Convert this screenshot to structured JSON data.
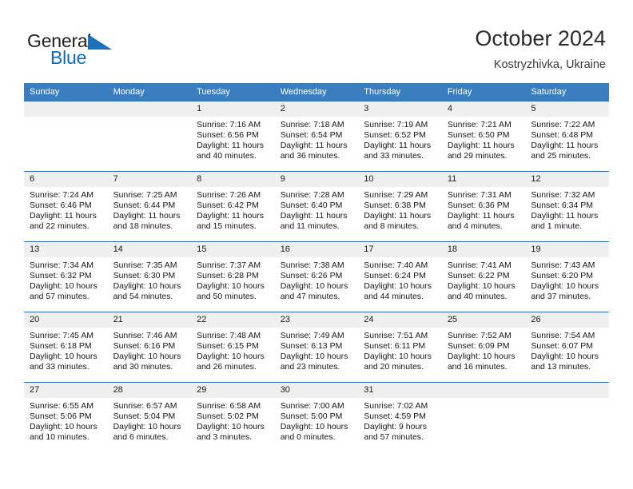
{
  "brand": {
    "name_part1": "General",
    "name_part2": "Blue",
    "flag_icon": "triangle-flag-icon"
  },
  "header": {
    "title": "October 2024",
    "location": "Kostryzhivka, Ukraine"
  },
  "colors": {
    "header_blue": "#3b7ebf",
    "row_rule_blue": "#2b6ca8",
    "daynum_gray": "#efefef",
    "brand_blue": "#0a6bc4"
  },
  "calendar": {
    "weekday_headers": [
      "Sunday",
      "Monday",
      "Tuesday",
      "Wednesday",
      "Thursday",
      "Friday",
      "Saturday"
    ],
    "weeks": [
      [
        {
          "day": "",
          "sunrise": "",
          "sunset": "",
          "daylight1": "",
          "daylight2": "",
          "empty": true
        },
        {
          "day": "",
          "sunrise": "",
          "sunset": "",
          "daylight1": "",
          "daylight2": "",
          "empty": true
        },
        {
          "day": "1",
          "sunrise": "Sunrise: 7:16 AM",
          "sunset": "Sunset: 6:56 PM",
          "daylight1": "Daylight: 11 hours",
          "daylight2": "and 40 minutes.",
          "empty": false
        },
        {
          "day": "2",
          "sunrise": "Sunrise: 7:18 AM",
          "sunset": "Sunset: 6:54 PM",
          "daylight1": "Daylight: 11 hours",
          "daylight2": "and 36 minutes.",
          "empty": false
        },
        {
          "day": "3",
          "sunrise": "Sunrise: 7:19 AM",
          "sunset": "Sunset: 6:52 PM",
          "daylight1": "Daylight: 11 hours",
          "daylight2": "and 33 minutes.",
          "empty": false
        },
        {
          "day": "4",
          "sunrise": "Sunrise: 7:21 AM",
          "sunset": "Sunset: 6:50 PM",
          "daylight1": "Daylight: 11 hours",
          "daylight2": "and 29 minutes.",
          "empty": false
        },
        {
          "day": "5",
          "sunrise": "Sunrise: 7:22 AM",
          "sunset": "Sunset: 6:48 PM",
          "daylight1": "Daylight: 11 hours",
          "daylight2": "and 25 minutes.",
          "empty": false
        }
      ],
      [
        {
          "day": "6",
          "sunrise": "Sunrise: 7:24 AM",
          "sunset": "Sunset: 6:46 PM",
          "daylight1": "Daylight: 11 hours",
          "daylight2": "and 22 minutes.",
          "empty": false
        },
        {
          "day": "7",
          "sunrise": "Sunrise: 7:25 AM",
          "sunset": "Sunset: 6:44 PM",
          "daylight1": "Daylight: 11 hours",
          "daylight2": "and 18 minutes.",
          "empty": false
        },
        {
          "day": "8",
          "sunrise": "Sunrise: 7:26 AM",
          "sunset": "Sunset: 6:42 PM",
          "daylight1": "Daylight: 11 hours",
          "daylight2": "and 15 minutes.",
          "empty": false
        },
        {
          "day": "9",
          "sunrise": "Sunrise: 7:28 AM",
          "sunset": "Sunset: 6:40 PM",
          "daylight1": "Daylight: 11 hours",
          "daylight2": "and 11 minutes.",
          "empty": false
        },
        {
          "day": "10",
          "sunrise": "Sunrise: 7:29 AM",
          "sunset": "Sunset: 6:38 PM",
          "daylight1": "Daylight: 11 hours",
          "daylight2": "and 8 minutes.",
          "empty": false
        },
        {
          "day": "11",
          "sunrise": "Sunrise: 7:31 AM",
          "sunset": "Sunset: 6:36 PM",
          "daylight1": "Daylight: 11 hours",
          "daylight2": "and 4 minutes.",
          "empty": false
        },
        {
          "day": "12",
          "sunrise": "Sunrise: 7:32 AM",
          "sunset": "Sunset: 6:34 PM",
          "daylight1": "Daylight: 11 hours",
          "daylight2": "and 1 minute.",
          "empty": false
        }
      ],
      [
        {
          "day": "13",
          "sunrise": "Sunrise: 7:34 AM",
          "sunset": "Sunset: 6:32 PM",
          "daylight1": "Daylight: 10 hours",
          "daylight2": "and 57 minutes.",
          "empty": false
        },
        {
          "day": "14",
          "sunrise": "Sunrise: 7:35 AM",
          "sunset": "Sunset: 6:30 PM",
          "daylight1": "Daylight: 10 hours",
          "daylight2": "and 54 minutes.",
          "empty": false
        },
        {
          "day": "15",
          "sunrise": "Sunrise: 7:37 AM",
          "sunset": "Sunset: 6:28 PM",
          "daylight1": "Daylight: 10 hours",
          "daylight2": "and 50 minutes.",
          "empty": false
        },
        {
          "day": "16",
          "sunrise": "Sunrise: 7:38 AM",
          "sunset": "Sunset: 6:26 PM",
          "daylight1": "Daylight: 10 hours",
          "daylight2": "and 47 minutes.",
          "empty": false
        },
        {
          "day": "17",
          "sunrise": "Sunrise: 7:40 AM",
          "sunset": "Sunset: 6:24 PM",
          "daylight1": "Daylight: 10 hours",
          "daylight2": "and 44 minutes.",
          "empty": false
        },
        {
          "day": "18",
          "sunrise": "Sunrise: 7:41 AM",
          "sunset": "Sunset: 6:22 PM",
          "daylight1": "Daylight: 10 hours",
          "daylight2": "and 40 minutes.",
          "empty": false
        },
        {
          "day": "19",
          "sunrise": "Sunrise: 7:43 AM",
          "sunset": "Sunset: 6:20 PM",
          "daylight1": "Daylight: 10 hours",
          "daylight2": "and 37 minutes.",
          "empty": false
        }
      ],
      [
        {
          "day": "20",
          "sunrise": "Sunrise: 7:45 AM",
          "sunset": "Sunset: 6:18 PM",
          "daylight1": "Daylight: 10 hours",
          "daylight2": "and 33 minutes.",
          "empty": false
        },
        {
          "day": "21",
          "sunrise": "Sunrise: 7:46 AM",
          "sunset": "Sunset: 6:16 PM",
          "daylight1": "Daylight: 10 hours",
          "daylight2": "and 30 minutes.",
          "empty": false
        },
        {
          "day": "22",
          "sunrise": "Sunrise: 7:48 AM",
          "sunset": "Sunset: 6:15 PM",
          "daylight1": "Daylight: 10 hours",
          "daylight2": "and 26 minutes.",
          "empty": false
        },
        {
          "day": "23",
          "sunrise": "Sunrise: 7:49 AM",
          "sunset": "Sunset: 6:13 PM",
          "daylight1": "Daylight: 10 hours",
          "daylight2": "and 23 minutes.",
          "empty": false
        },
        {
          "day": "24",
          "sunrise": "Sunrise: 7:51 AM",
          "sunset": "Sunset: 6:11 PM",
          "daylight1": "Daylight: 10 hours",
          "daylight2": "and 20 minutes.",
          "empty": false
        },
        {
          "day": "25",
          "sunrise": "Sunrise: 7:52 AM",
          "sunset": "Sunset: 6:09 PM",
          "daylight1": "Daylight: 10 hours",
          "daylight2": "and 16 minutes.",
          "empty": false
        },
        {
          "day": "26",
          "sunrise": "Sunrise: 7:54 AM",
          "sunset": "Sunset: 6:07 PM",
          "daylight1": "Daylight: 10 hours",
          "daylight2": "and 13 minutes.",
          "empty": false
        }
      ],
      [
        {
          "day": "27",
          "sunrise": "Sunrise: 6:55 AM",
          "sunset": "Sunset: 5:06 PM",
          "daylight1": "Daylight: 10 hours",
          "daylight2": "and 10 minutes.",
          "empty": false
        },
        {
          "day": "28",
          "sunrise": "Sunrise: 6:57 AM",
          "sunset": "Sunset: 5:04 PM",
          "daylight1": "Daylight: 10 hours",
          "daylight2": "and 6 minutes.",
          "empty": false
        },
        {
          "day": "29",
          "sunrise": "Sunrise: 6:58 AM",
          "sunset": "Sunset: 5:02 PM",
          "daylight1": "Daylight: 10 hours",
          "daylight2": "and 3 minutes.",
          "empty": false
        },
        {
          "day": "30",
          "sunrise": "Sunrise: 7:00 AM",
          "sunset": "Sunset: 5:00 PM",
          "daylight1": "Daylight: 10 hours",
          "daylight2": "and 0 minutes.",
          "empty": false
        },
        {
          "day": "31",
          "sunrise": "Sunrise: 7:02 AM",
          "sunset": "Sunset: 4:59 PM",
          "daylight1": "Daylight: 9 hours",
          "daylight2": "and 57 minutes.",
          "empty": false
        },
        {
          "day": "",
          "sunrise": "",
          "sunset": "",
          "daylight1": "",
          "daylight2": "",
          "empty": true
        },
        {
          "day": "",
          "sunrise": "",
          "sunset": "",
          "daylight1": "",
          "daylight2": "",
          "empty": true
        }
      ]
    ]
  }
}
